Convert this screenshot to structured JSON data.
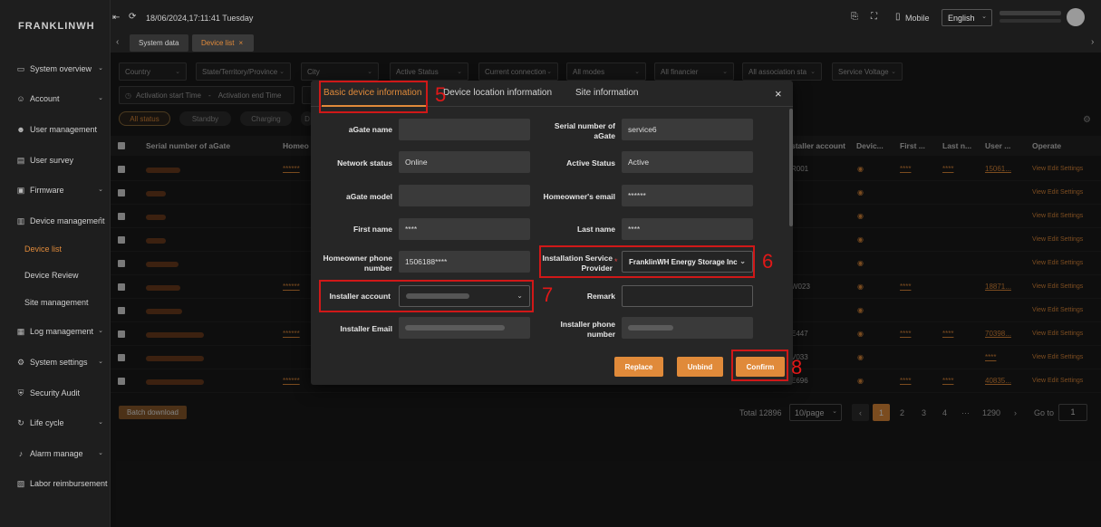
{
  "sidebar": {
    "logo": "FRANKLINWH",
    "items": [
      {
        "label": "System overview",
        "icon": "monitor-icon",
        "chev": "⌄"
      },
      {
        "label": "Account",
        "icon": "user-plus-icon",
        "chev": "⌄"
      },
      {
        "label": "User management",
        "icon": "users-icon"
      },
      {
        "label": "User survey",
        "icon": "chart-icon"
      },
      {
        "label": "Firmware",
        "icon": "chip-icon",
        "chev": "⌄"
      },
      {
        "label": "Device management",
        "icon": "document-icon",
        "chev": "⌃"
      },
      {
        "label": "Device list",
        "sub": true,
        "active": true
      },
      {
        "label": "Device Review",
        "sub": true
      },
      {
        "label": "Site management",
        "sub": true
      },
      {
        "label": "Log management",
        "icon": "log-icon",
        "chev": "⌄"
      },
      {
        "label": "System settings",
        "icon": "gear-icon",
        "chev": "⌄"
      },
      {
        "label": "Security Audit",
        "icon": "shield-icon"
      },
      {
        "label": "Life cycle",
        "icon": "cycle-icon",
        "chev": "⌄"
      },
      {
        "label": "Alarm manage",
        "icon": "bell-icon",
        "chev": "⌄"
      },
      {
        "label": "Labor reimbursement",
        "icon": "wallet-icon"
      }
    ]
  },
  "topbar": {
    "datetime": "18/06/2024,17:11:41 Tuesday",
    "mobile_label": "Mobile",
    "language": "English"
  },
  "tabs": [
    {
      "label": "System data"
    },
    {
      "label": "Device list",
      "close": "×"
    }
  ],
  "filters": [
    "Country",
    "State/Territory/Province",
    "City",
    "Active Status",
    "Current connection",
    "All modes",
    "All financier",
    "All association sta",
    "Service Voltage"
  ],
  "date_range": {
    "start": "Activation start Time",
    "sep": "-",
    "end": "Activation end Time"
  },
  "status_pills": [
    "All status",
    "Standby",
    "Charging",
    "D"
  ],
  "table": {
    "headers": [
      "Serial number of aGate",
      "Homeo",
      "staller account",
      "Devic...",
      "First ...",
      "Last n...",
      "User ...",
      "Operate"
    ],
    "ops": "View  Edit  Settings",
    "rows": [
      {
        "home": "******",
        "installer": "R001",
        "first": "****",
        "last": "****",
        "user": "15061..."
      },
      {
        "home": "",
        "installer": "",
        "first": "",
        "last": "",
        "user": ""
      },
      {
        "home": "",
        "installer": "",
        "first": "",
        "last": "",
        "user": ""
      },
      {
        "home": "",
        "installer": "",
        "first": "",
        "last": "",
        "user": ""
      },
      {
        "home": "",
        "installer": "",
        "first": "",
        "last": "",
        "user": ""
      },
      {
        "home": "******",
        "installer": "W023",
        "first": "****",
        "last": "",
        "user": "18871..."
      },
      {
        "home": "",
        "installer": "",
        "first": "",
        "last": "",
        "user": ""
      },
      {
        "home": "******",
        "installer": "E447",
        "first": "****",
        "last": "****",
        "user": "70398..."
      },
      {
        "home": "",
        "installer": "V033",
        "first": "",
        "last": "",
        "user": "****"
      },
      {
        "home": "******",
        "installer": "E696",
        "first": "****",
        "last": "****",
        "user": "40835..."
      }
    ]
  },
  "footer": {
    "batch_download": "Batch download",
    "total": "Total 12896",
    "page_size": "10/page",
    "pages": [
      "1",
      "2",
      "3",
      "4",
      "···",
      "1290"
    ],
    "goto_label": "Go to",
    "goto_value": "1"
  },
  "modal": {
    "tabs": [
      "Basic device information",
      "Device location information",
      "Site information"
    ],
    "close": "×",
    "fields_left": [
      {
        "label": "aGate name",
        "value": ""
      },
      {
        "label": "Network status",
        "value": "Online"
      },
      {
        "label": "aGate model",
        "value": ""
      },
      {
        "label": "First name",
        "value": "****"
      },
      {
        "label": "Homeowner phone number",
        "value": "1506188****"
      },
      {
        "label": "Installer account",
        "value": ""
      },
      {
        "label": "Installer Email",
        "value": ""
      }
    ],
    "fields_right": [
      {
        "label": "Serial number of aGate",
        "value": "service6"
      },
      {
        "label": "Active Status",
        "value": "Active"
      },
      {
        "label": "Homeowner's email",
        "value": "******"
      },
      {
        "label": "Last name",
        "value": "****"
      },
      {
        "label": "Installation Service Provider",
        "value": "FranklinWH Energy Storage Inc",
        "required": "*"
      },
      {
        "label": "Remark",
        "value": ""
      },
      {
        "label": "Installer phone number",
        "value": ""
      }
    ],
    "buttons": {
      "replace": "Replace",
      "unbind": "Unbind",
      "confirm": "Confirm"
    }
  },
  "annotations": [
    "5",
    "6",
    "7",
    "8"
  ],
  "colors": {
    "accent": "#e08a3a",
    "annotation_red": "#d01818",
    "bg": "#1b1b1b"
  }
}
